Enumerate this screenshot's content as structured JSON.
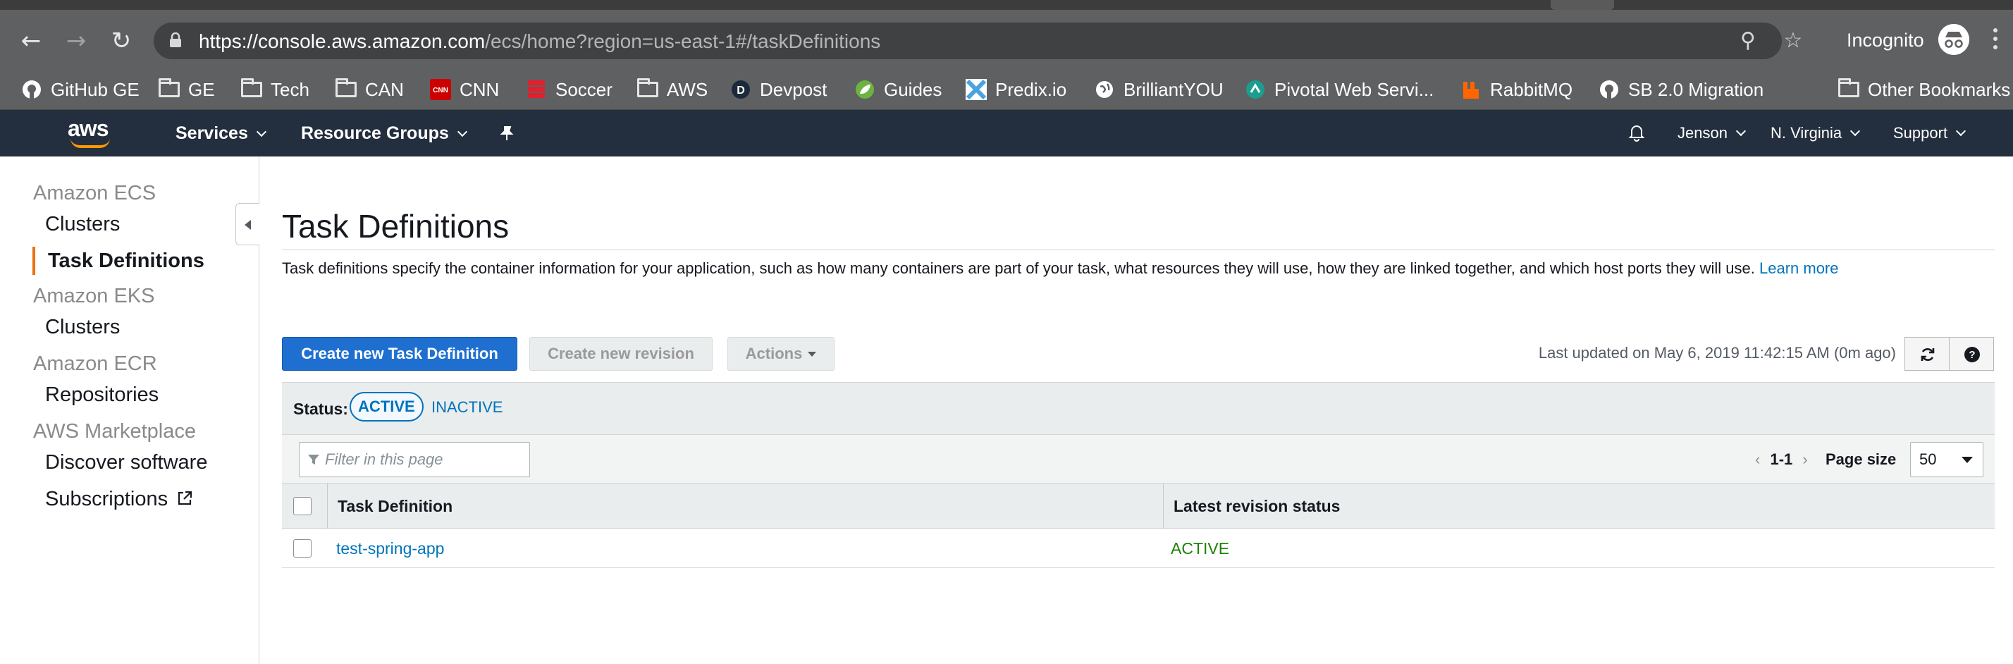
{
  "browser": {
    "url_host": "https://console.aws.amazon.com",
    "url_path": "/ecs/home?region=us-east-1#/taskDefinitions",
    "mode_label": "Incognito",
    "bookmarks": [
      {
        "label": "GitHub GE",
        "icon": "github-icon"
      },
      {
        "label": "GE",
        "icon": "folder-icon"
      },
      {
        "label": "Tech",
        "icon": "folder-icon"
      },
      {
        "label": "CAN",
        "icon": "folder-icon"
      },
      {
        "label": "CNN",
        "icon": "cnn-icon"
      },
      {
        "label": "Soccer",
        "icon": "soccer-icon"
      },
      {
        "label": "AWS",
        "icon": "folder-icon"
      },
      {
        "label": "Devpost",
        "icon": "devpost-icon"
      },
      {
        "label": "Guides",
        "icon": "spring-icon"
      },
      {
        "label": "Predix.io",
        "icon": "predix-icon"
      },
      {
        "label": "BrilliantYOU",
        "icon": "globe-icon"
      },
      {
        "label": "Pivotal Web Servi...",
        "icon": "pivotal-icon"
      },
      {
        "label": "RabbitMQ",
        "icon": "rabbitmq-icon"
      },
      {
        "label": "SB 2.0 Migration",
        "icon": "github-icon"
      },
      {
        "label": "Other Bookmarks",
        "icon": "folder-icon"
      }
    ]
  },
  "aws_nav": {
    "logo": "aws",
    "services_label": "Services",
    "resource_groups_label": "Resource Groups",
    "user_label": "Jenson",
    "region_label": "N. Virginia",
    "support_label": "Support"
  },
  "sidebar": {
    "sections": [
      {
        "title": "Amazon ECS",
        "items": [
          "Clusters",
          "Task Definitions"
        ]
      },
      {
        "title": "Amazon EKS",
        "items": [
          "Clusters"
        ]
      },
      {
        "title": "Amazon ECR",
        "items": [
          "Repositories"
        ]
      },
      {
        "title": "AWS Marketplace",
        "items": [
          "Discover software",
          "Subscriptions"
        ]
      }
    ],
    "active_item": "Task Definitions"
  },
  "main": {
    "title": "Task Definitions",
    "description": "Task definitions specify the container information for your application, such as how many containers are part of your task, what resources they will use, how they are linked together, and which host ports they will use.",
    "learn_more": "Learn more",
    "create_button": "Create new Task Definition",
    "revision_button": "Create new revision",
    "actions_button": "Actions",
    "last_updated": "Last updated on May 6, 2019 11:42:15 AM (0m ago)",
    "status_label": "Status:",
    "status_active": "ACTIVE",
    "status_inactive": "INACTIVE",
    "filter_placeholder": "Filter in this page",
    "pagination": "1-1",
    "page_size_label": "Page size",
    "page_size_value": "50",
    "columns": [
      "Task Definition",
      "Latest revision status"
    ],
    "rows": [
      {
        "name": "test-spring-app",
        "status": "ACTIVE"
      }
    ]
  },
  "colors": {
    "aws_nav_bg": "#232f3e",
    "primary_button": "#1f6fd1",
    "link": "#0073bb",
    "status_active": "#1d8102",
    "sidebar_active_bar": "#ec7211"
  }
}
